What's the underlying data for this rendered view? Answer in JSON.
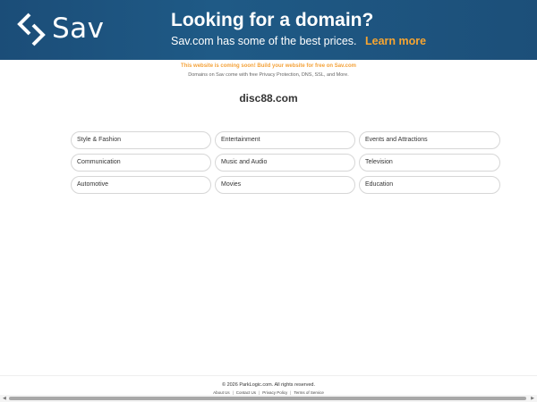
{
  "banner": {
    "brand": "Sav",
    "logo_icon": "sav-logo-icon",
    "headline": "Looking for a domain?",
    "subtext": "Sav.com has some of the best prices.",
    "cta": "Learn more",
    "colors": {
      "background": "#1d5482",
      "cta": "#f7a531",
      "text": "#ffffff"
    }
  },
  "notice": {
    "headline": "This website is coming soon! Build your website for free on Sav.com",
    "subtext": "Domains on Sav come with free Privacy Protection, DNS, SSL, and More."
  },
  "domain": "disc88.com",
  "links": {
    "row1": [
      "Style & Fashion",
      "Entertainment",
      "Events and Attractions"
    ],
    "row2": [
      "Communication",
      "Music and Audio",
      "Television"
    ],
    "row3": [
      "Automotive",
      "Movies",
      "Education"
    ]
  },
  "footer": {
    "copyright": "© 2026 ParkLogic.com. All rights reserved.",
    "links": [
      "About Us",
      "Contact Us",
      "Privacy Policy",
      "Terms of Service"
    ],
    "separator": "|"
  },
  "scrollbar": {
    "left_arrow": "◀",
    "right_arrow": "▶"
  }
}
